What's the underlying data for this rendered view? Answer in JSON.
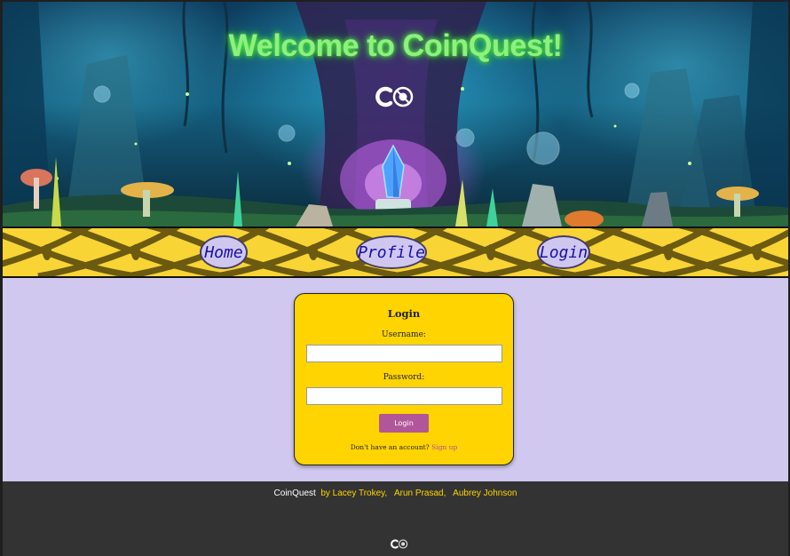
{
  "hero": {
    "title": "Welcome to CoinQuest!",
    "logo_icon": "coinquest-logo-icon"
  },
  "nav": {
    "items": [
      {
        "label": "Home"
      },
      {
        "label": "Profile"
      },
      {
        "label": "Login"
      }
    ]
  },
  "login": {
    "title": "Login",
    "username_label": "Username:",
    "username_value": "",
    "password_label": "Password:",
    "password_value": "",
    "button_label": "Login",
    "signup_prompt": "Don't have an account?",
    "signup_link": "Sign up"
  },
  "footer": {
    "brand": "CoinQuest",
    "by": "by Lacey Trokey,",
    "author2": "Arun Prasad,",
    "author3": "Aubrey Johnson",
    "logo_icon": "coinquest-logo-icon"
  },
  "colors": {
    "nav_bg": "#f8d435",
    "card_bg": "#ffd400",
    "page_bg": "#d0c8ee",
    "login_button": "#b2569a",
    "footer_bg": "#333333",
    "title_green": "#8ef07f"
  }
}
